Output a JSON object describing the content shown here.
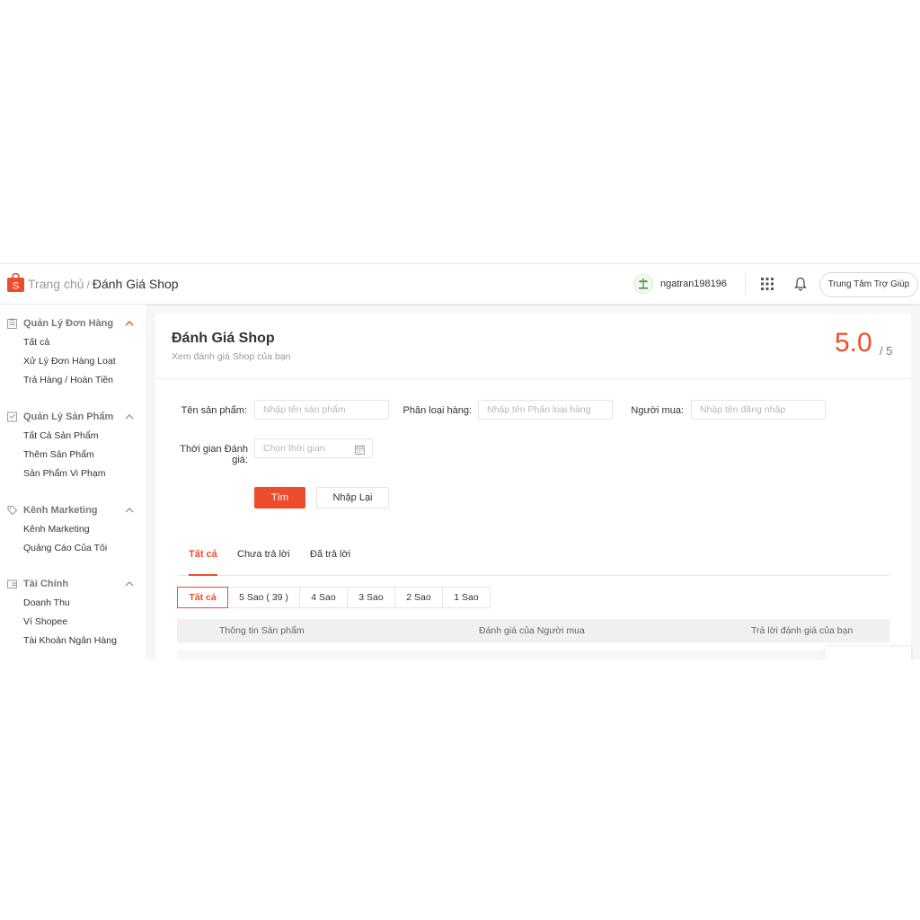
{
  "header": {
    "breadcrumb_home": "Trang chủ",
    "breadcrumb_sep": "/",
    "breadcrumb_current": "Đánh Giá Shop",
    "username": "ngatran198196",
    "help_label": "Trung Tâm Trợ Giúp",
    "brand_color": "#ee4d2d"
  },
  "sidebar": {
    "sections": [
      {
        "title": "Quản Lý Đơn Hàng",
        "icon": "clipboard-icon",
        "items": [
          "Tất cả",
          "Xử Lý Đơn Hàng Loạt",
          "Trả Hàng / Hoàn Tiền"
        ]
      },
      {
        "title": "Quản Lý Sản Phẩm",
        "icon": "product-box-icon",
        "items": [
          "Tất Cả Sản Phẩm",
          "Thêm Sản Phẩm",
          "Sản Phẩm Vi Phạm"
        ]
      },
      {
        "title": "Kênh Marketing",
        "icon": "tag-icon",
        "items": [
          "Kênh Marketing",
          "Quảng Cáo Của Tôi"
        ]
      },
      {
        "title": "Tài Chính",
        "icon": "wallet-icon",
        "items": [
          "Doanh Thu",
          "Ví Shopee",
          "Tài Khoản Ngân Hàng"
        ]
      }
    ]
  },
  "main": {
    "title": "Đánh Giá Shop",
    "subtitle": "Xem đánh giá Shop của bạn",
    "score": "5.0",
    "score_max": "/ 5",
    "form": {
      "product_label": "Tên sản phẩm:",
      "product_placeholder": "Nhập tên sản phẩm",
      "variant_label": "Phân loại hàng:",
      "variant_placeholder": "Nhập tên Phân loại hàng",
      "buyer_label": "Người mua:",
      "buyer_placeholder": "Nhập tên đăng nhập",
      "time_label_1": "Thời gian Đánh",
      "time_label_2": "giá:",
      "time_placeholder": "Chọn thời gian",
      "search_btn": "Tìm",
      "reset_btn": "Nhập Lại"
    },
    "tabs": [
      "Tất cả",
      "Chưa trả lời",
      "Đã trả lời"
    ],
    "star_filters": [
      "Tất cả",
      "5 Sao ( 39 )",
      "4 Sao",
      "3 Sao",
      "2 Sao",
      "1 Sao"
    ],
    "table_headers": [
      "Thông tin Sản phẩm",
      "Đánh giá của Người mua",
      "Trả lời đánh giá của bạn"
    ]
  }
}
